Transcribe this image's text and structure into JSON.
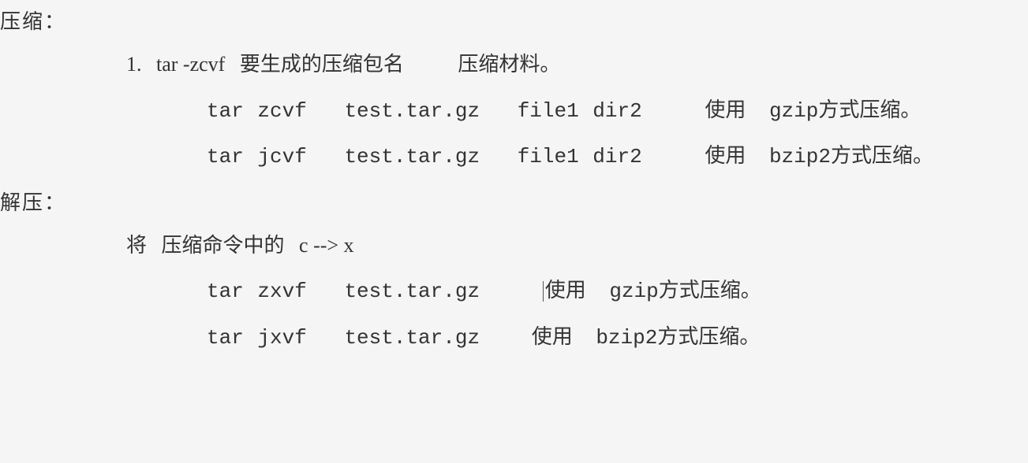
{
  "compress": {
    "title": "压缩：",
    "line1_prefix": "1.",
    "line1_cmd": "tar -zcvf",
    "line1_desc1": "要生成的压缩包名",
    "line1_desc2": "压缩材料。",
    "example1_cmd": "tar zcvf",
    "example1_file": "test.tar.gz",
    "example1_args": "file1 dir2",
    "example1_note_prefix": "使用",
    "example1_note": "gzip方式压缩。",
    "example2_cmd": "tar jcvf",
    "example2_file": "test.tar.gz",
    "example2_args": "file1 dir2",
    "example2_note_prefix": "使用",
    "example2_note": "bzip2方式压缩。"
  },
  "decompress": {
    "title": "解压：",
    "sub_prefix": "将",
    "sub_text": "压缩命令中的",
    "sub_arrow": "c --> x",
    "example1_cmd": "tar zxvf",
    "example1_file": "test.tar.gz",
    "example1_note_prefix": "使用",
    "example1_note": "gzip方式压缩。",
    "example2_cmd": "tar jxvf",
    "example2_file": "test.tar.gz",
    "example2_note_prefix": "使用",
    "example2_note": "bzip2方式压缩。"
  }
}
